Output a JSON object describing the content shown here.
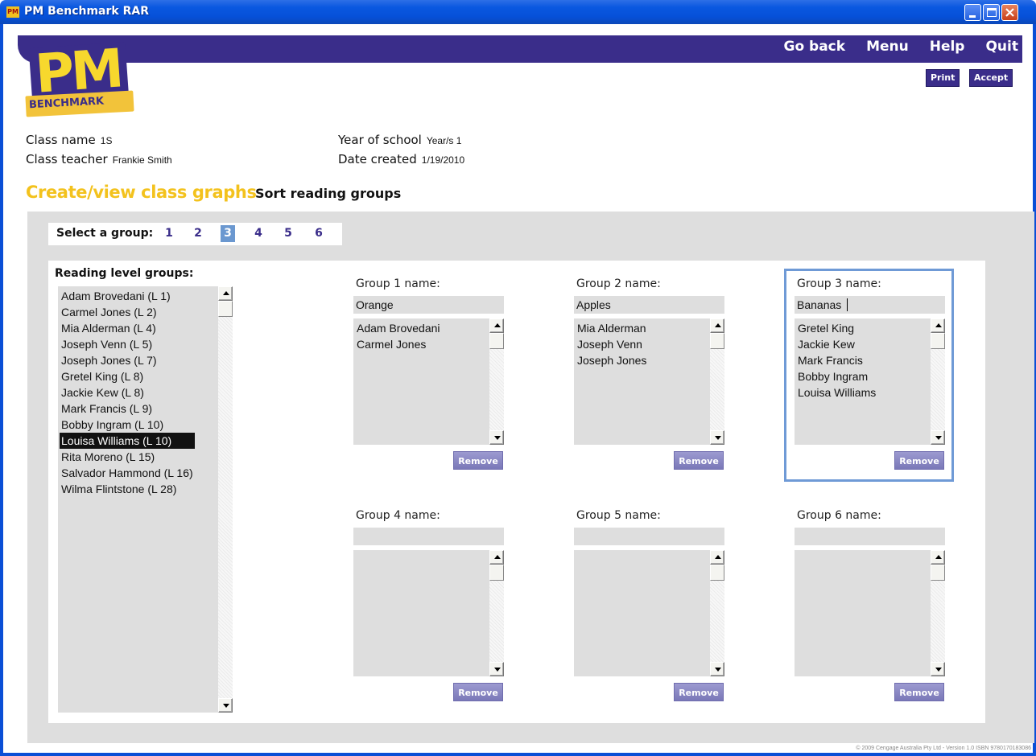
{
  "window": {
    "title": "PM Benchmark RAR",
    "icon_text": "PM"
  },
  "nav": {
    "go_back": "Go back",
    "menu": "Menu",
    "help": "Help",
    "quit": "Quit",
    "print": "Print",
    "accept": "Accept"
  },
  "logo": {
    "top": "PM",
    "bottom": "BENCHMARK"
  },
  "class_info": {
    "class_name_label": "Class name",
    "class_name": "1S",
    "class_teacher_label": "Class teacher",
    "class_teacher": "Frankie Smith",
    "year_label": "Year of school",
    "year": "Year/s 1",
    "date_label": "Date created",
    "date": "1/19/2010"
  },
  "tabs": {
    "graphs": "Create/view class graphs",
    "sort": "Sort reading groups"
  },
  "selector": {
    "label": "Select a group:",
    "numbers": [
      "1",
      "2",
      "3",
      "4",
      "5",
      "6"
    ],
    "active": "3"
  },
  "reading_levels": {
    "label": "Reading level groups:",
    "items": [
      "Adam Brovedani (L 1)",
      "Carmel Jones (L 2)",
      "Mia Alderman (L 4)",
      "Joseph Venn (L 5)",
      "Joseph Jones (L 7)",
      "Gretel King (L 8)",
      "Jackie Kew (L 8)",
      "Mark Francis (L 9)",
      "Bobby Ingram (L 10)",
      "Louisa Williams (L 10)",
      "Rita Moreno (L 15)",
      "Salvador Hammond (L 16)",
      "Wilma Flintstone (L 28)"
    ],
    "selected": "Louisa Williams (L 10)"
  },
  "groups": [
    {
      "label": "Group 1 name:",
      "name": "Orange",
      "members": [
        "Adam Brovedani",
        "Carmel Jones"
      ],
      "remove": "Remove"
    },
    {
      "label": "Group 2 name:",
      "name": "Apples",
      "members": [
        "Mia Alderman",
        "Joseph Venn",
        "Joseph Jones"
      ],
      "remove": "Remove"
    },
    {
      "label": "Group 3 name:",
      "name": "Bananas",
      "members": [
        "Gretel King",
        "Jackie Kew",
        "Mark Francis",
        "Bobby Ingram",
        "Louisa Williams"
      ],
      "remove": "Remove"
    },
    {
      "label": "Group 4 name:",
      "name": "",
      "members": [],
      "remove": "Remove"
    },
    {
      "label": "Group 5 name:",
      "name": "",
      "members": [],
      "remove": "Remove"
    },
    {
      "label": "Group 6 name:",
      "name": "",
      "members": [],
      "remove": "Remove"
    }
  ],
  "footer": {
    "copyright": "© 2009 Cengage Australia Pty Ltd - Version 1.0 ISBN 9780170183086"
  },
  "colors": {
    "title_bar": "#0a58e0",
    "brand_purple": "#3a2d8a",
    "brand_yellow": "#f3c21d",
    "active_group": "#6b98d0"
  }
}
